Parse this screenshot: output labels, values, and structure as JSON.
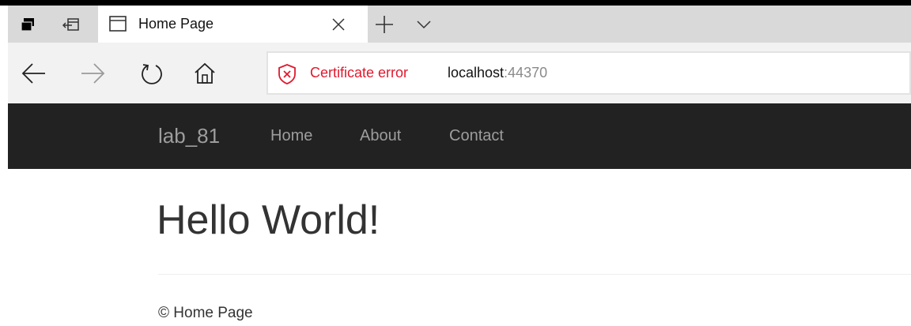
{
  "browser": {
    "tab": {
      "title": "Home Page"
    },
    "address": {
      "security_label": "Certificate error",
      "host": "localhost",
      "port": ":44370"
    }
  },
  "site": {
    "brand": "lab_81",
    "nav": {
      "home": "Home",
      "about": "About",
      "contact": "Contact"
    },
    "heading": "Hello World!",
    "footer": "© Home Page"
  },
  "colors": {
    "navbar_bg": "#222222",
    "nav_text": "#9d9d9d",
    "cert_error": "#e0192e",
    "tab_strip": "#d9d9d9",
    "address_bar": "#f2f2f2"
  },
  "icons": [
    "task-view-icon",
    "set-aside-tabs-icon",
    "tab-page-icon",
    "close-icon",
    "plus-icon",
    "chevron-down-icon",
    "back-arrow-icon",
    "forward-arrow-icon",
    "refresh-icon",
    "home-icon",
    "shield-x-icon"
  ]
}
